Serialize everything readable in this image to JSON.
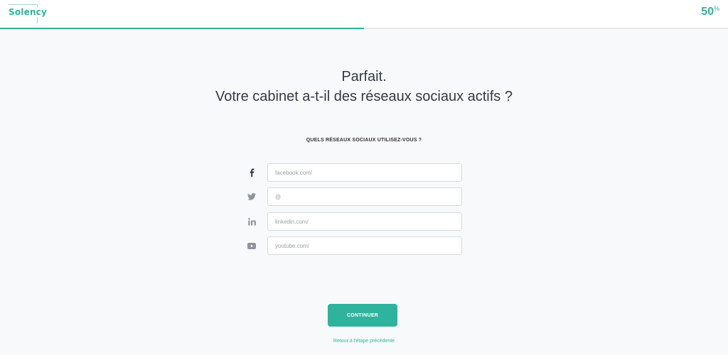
{
  "brand": {
    "logo_text": "Solency",
    "accent_color": "#2fb39d"
  },
  "progress": {
    "value_percent": 50,
    "display": "50",
    "unit": "%"
  },
  "question": {
    "line1": "Parfait.",
    "line2": "Votre cabinet a-t-il des réseaux sociaux actifs ?"
  },
  "social_section": {
    "label": "QUELS RÉSEAUX SOCIAUX UTILISEZ-VOUS ?"
  },
  "fields": [
    {
      "icon": "facebook-icon",
      "placeholder": "facebook.com/",
      "value": ""
    },
    {
      "icon": "twitter-icon",
      "placeholder": "@",
      "value": ""
    },
    {
      "icon": "linkedin-icon",
      "placeholder": "linkedin.com/",
      "value": ""
    },
    {
      "icon": "youtube-icon",
      "placeholder": "youtube.com/",
      "value": ""
    }
  ],
  "actions": {
    "continue_label": "CONTINUER",
    "back_label": "Retour à l'étape précédente"
  }
}
